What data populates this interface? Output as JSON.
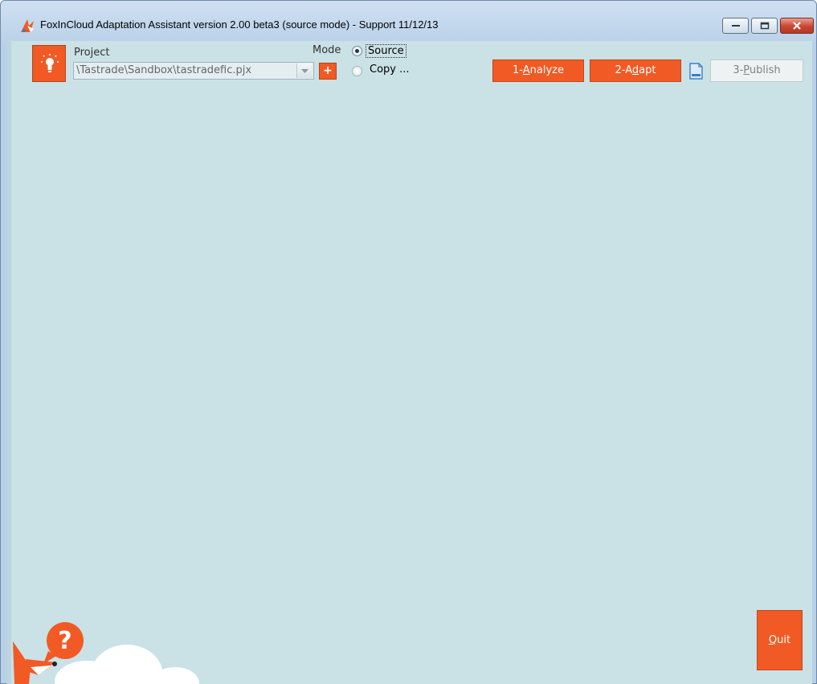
{
  "window": {
    "title": "FoxInCloud Adaptation Assistant version 2.00 beta3 (source mode) - Support 11/12/13",
    "controls": [
      "minimize-icon",
      "maximize-icon",
      "close-icon"
    ]
  },
  "project": {
    "label": "Project",
    "path": "\\Tastrade\\Sandbox\\tastradefic.pjx",
    "add_label": "+"
  },
  "mode": {
    "label": "Mode",
    "options": [
      {
        "label": "Source",
        "selected": true
      },
      {
        "label": "Copy ...",
        "selected": false
      }
    ]
  },
  "actions": {
    "analyze": {
      "prefix": "1-",
      "accel": "A",
      "rest": "nalyze"
    },
    "adapt": {
      "prefix": "2-A",
      "accel": "d",
      "rest": "apt"
    },
    "publish": {
      "prefix": "3-",
      "accel": "P",
      "rest": "ublish"
    }
  },
  "quit": {
    "accel": "Q",
    "rest": "uit"
  },
  "icons": {
    "app": "fox-logo-icon",
    "logo_button": "lightbulb-icon",
    "doc": "document-icon",
    "help": "question-mark-icon"
  },
  "colors": {
    "accent": "#f15a24",
    "client_bg": "#cae1e6",
    "disabled_button": "#eef2f2"
  }
}
